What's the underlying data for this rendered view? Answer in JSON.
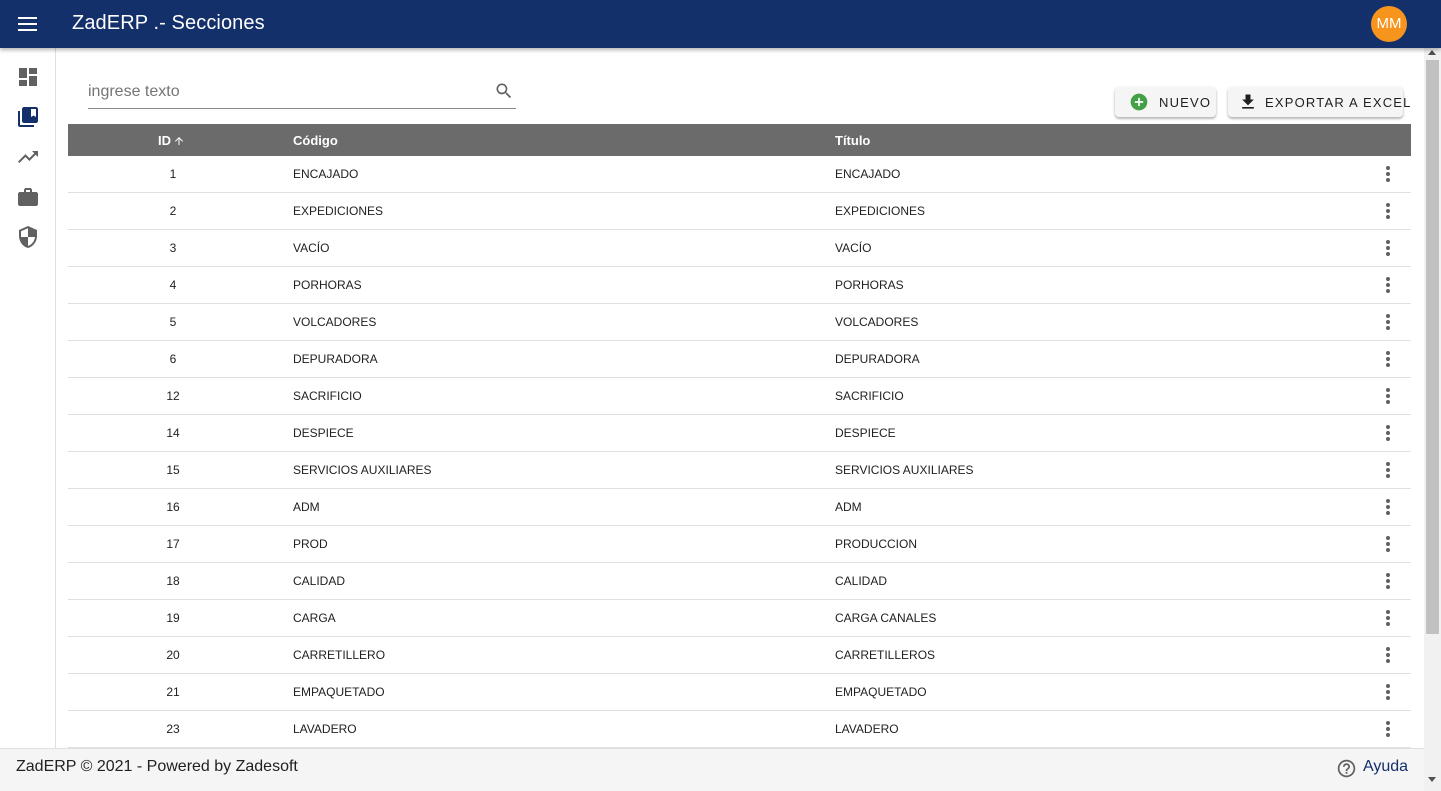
{
  "app": {
    "title": "ZadERP .- Secciones",
    "avatar_initials": "MM",
    "avatar_color": "#f7941d",
    "brand_color": "#13306a"
  },
  "sidebar": {
    "items": [
      {
        "icon": "dashboard-icon"
      },
      {
        "icon": "library-books-icon",
        "active": true
      },
      {
        "icon": "trending-up-icon"
      },
      {
        "icon": "briefcase-icon"
      },
      {
        "icon": "shield-icon"
      }
    ]
  },
  "search": {
    "placeholder": "ingrese texto",
    "value": ""
  },
  "toolbar": {
    "new_label": "NUEVO",
    "export_label": "EXPORTAR A EXCEL"
  },
  "table": {
    "columns": [
      "ID",
      "Código",
      "Título"
    ],
    "sort": {
      "column": "ID",
      "direction": "asc"
    },
    "rows": [
      {
        "id": "1",
        "code": "ENCAJADO",
        "title": "ENCAJADO"
      },
      {
        "id": "2",
        "code": "EXPEDICIONES",
        "title": "EXPEDICIONES"
      },
      {
        "id": "3",
        "code": "VACÍO",
        "title": "VACÍO"
      },
      {
        "id": "4",
        "code": "PORHORAS",
        "title": "PORHORAS"
      },
      {
        "id": "5",
        "code": "VOLCADORES",
        "title": "VOLCADORES"
      },
      {
        "id": "6",
        "code": "DEPURADORA",
        "title": "DEPURADORA"
      },
      {
        "id": "12",
        "code": "SACRIFICIO",
        "title": "SACRIFICIO"
      },
      {
        "id": "14",
        "code": "DESPIECE",
        "title": "DESPIECE"
      },
      {
        "id": "15",
        "code": "SERVICIOS AUXILIARES",
        "title": "SERVICIOS AUXILIARES"
      },
      {
        "id": "16",
        "code": "ADM",
        "title": "ADM"
      },
      {
        "id": "17",
        "code": "PROD",
        "title": "PRODUCCION"
      },
      {
        "id": "18",
        "code": "CALIDAD",
        "title": "CALIDAD"
      },
      {
        "id": "19",
        "code": "CARGA",
        "title": "CARGA CANALES"
      },
      {
        "id": "20",
        "code": "CARRETILLERO",
        "title": "CARRETILLEROS"
      },
      {
        "id": "21",
        "code": "EMPAQUETADO",
        "title": "EMPAQUETADO"
      },
      {
        "id": "23",
        "code": "LAVADERO",
        "title": "LAVADERO"
      }
    ]
  },
  "footer": {
    "text": "ZadERP © 2021 - Powered by Zadesoft",
    "help_label": "Ayuda"
  }
}
